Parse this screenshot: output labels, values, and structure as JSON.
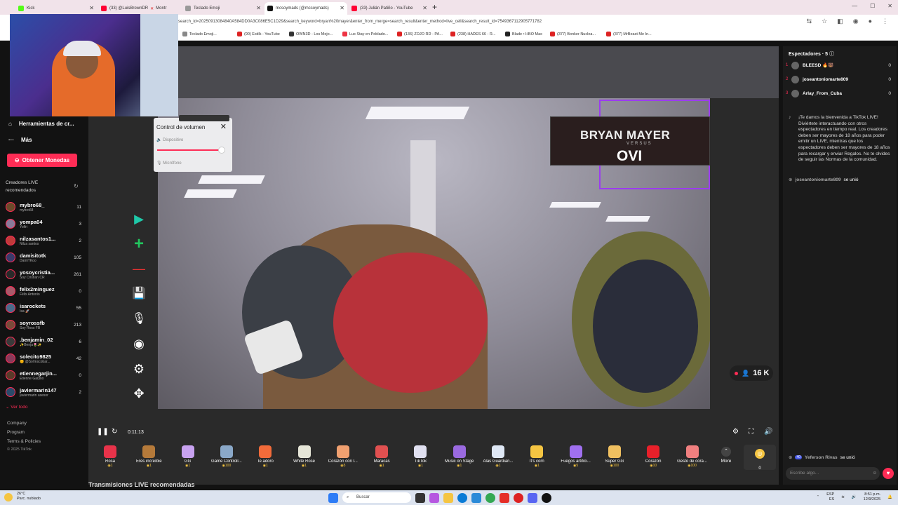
{
  "browser": {
    "tabs": [
      {
        "label": "Kick",
        "color": "#53fc18"
      },
      {
        "label": "(33) @LuisBrownDR",
        "color": "#ff0033"
      },
      {
        "label": "Montr",
        "color": "#888888"
      },
      {
        "label": "Teclado Emoji",
        "color": "#999999"
      },
      {
        "label": "mcsoymads (@mcsoymads)",
        "color": "#111111"
      },
      {
        "label": "(33) Julián Patiño - YouTube",
        "color": "#ff0033"
      }
    ],
    "new_tab": "+",
    "url": "search_id=20250913084840A584DD0A3C086E5C1D29&search_keyword=bryan%20mayer&enter_from_merge=search_result&enter_method=live_cell&search_result_id=7549367112905771782",
    "bookmarks": [
      "Teclado Emoji...",
      "(90) Estilk - YouTube",
      "OWN3D - Los Mejo...",
      "Lux Stay en Poblado...",
      "(136) ZOJO RD - PA...",
      "(238) HADES 66 - R...",
      "Blade • HBO Max",
      "(377) Bonker Nuclea...",
      "(377) MrBeast Me In..."
    ]
  },
  "sidebar": {
    "tools_label": "Herramientas de cr...",
    "more_label": "Más",
    "coins_button": "Obtener Monedas",
    "recommended_title": "Creadores LIVE recomendados",
    "creators": [
      {
        "name": "mybro68_",
        "sub": "mybro68",
        "count": "11"
      },
      {
        "name": "yompa04",
        "sub": "Yolfri",
        "count": "3"
      },
      {
        "name": "nilzasantos1...",
        "sub": "Nilza santos",
        "count": "2"
      },
      {
        "name": "damisitotk",
        "sub": "DamiTKoo",
        "count": "105"
      },
      {
        "name": "yosoycristia...",
        "sub": "Soy Cristian CR",
        "count": "261"
      },
      {
        "name": "felix2minguez",
        "sub": "Félix Antonio",
        "count": "0"
      },
      {
        "name": "isarockets",
        "sub": "Isa 🚀",
        "count": "55"
      },
      {
        "name": "soyrossfb",
        "sub": "Soy Ross FB",
        "count": "213"
      },
      {
        "name": ".benjamin_02",
        "sub": "✨Benja🌷✨",
        "count": "6"
      },
      {
        "name": "solecito9825",
        "sub": "🌞 @Sol Escobar...",
        "count": "42"
      },
      {
        "name": "etiennegarjin...",
        "sub": "Etienne Garjino",
        "count": "0"
      },
      {
        "name": "javiermarin147",
        "sub": "javiermarin asesor",
        "count": "2"
      }
    ],
    "see_all": "Ver todo",
    "footer_links": [
      "Company",
      "Program",
      "Terms & Policies"
    ],
    "copyright": "© 2025 TikTok"
  },
  "volume_popup": {
    "title": "Control de volumen",
    "device_label": "Dispositivo",
    "mic_label": "Micrófono",
    "level": 0.9
  },
  "video": {
    "overlay_title": "BRYAN MAYER",
    "overlay_versus": "VERSUS",
    "overlay_name": "OVI",
    "viewers": "16 K"
  },
  "controls": {
    "time": "0:11:13"
  },
  "gifts": [
    {
      "name": "Rosa",
      "cost": "1",
      "color": "#e8334a"
    },
    {
      "name": "Eres increíble",
      "cost": "1",
      "color": "#b57a3a"
    },
    {
      "name": "GG",
      "cost": "1",
      "color": "#c8a2f0"
    },
    {
      "name": "Game Controll...",
      "cost": "100",
      "color": "#8aa8c8"
    },
    {
      "name": "Te adoro",
      "cost": "1",
      "color": "#f26b3a"
    },
    {
      "name": "White Rose",
      "cost": "1",
      "color": "#e6e6d8"
    },
    {
      "name": "Corazón con l...",
      "cost": "5",
      "color": "#f0a070"
    },
    {
      "name": "Maracas",
      "cost": "1",
      "color": "#e05050"
    },
    {
      "name": "TikTok",
      "cost": "1",
      "color": "#e0e0f0"
    },
    {
      "name": "Music on Stage",
      "cost": "1",
      "color": "#9a6ae0"
    },
    {
      "name": "Alas Guardian...",
      "cost": "1",
      "color": "#dfe8f5"
    },
    {
      "name": "It's corn",
      "cost": "1",
      "color": "#f5c542"
    },
    {
      "name": "Fuegos artifici...",
      "cost": "5",
      "color": "#a070f0"
    },
    {
      "name": "Súper GG",
      "cost": "100",
      "color": "#f0c060"
    },
    {
      "name": "Corazón",
      "cost": "10",
      "color": "#e8202a"
    },
    {
      "name": "Gesto de cora...",
      "cost": "100",
      "color": "#f08080"
    }
  ],
  "more_gifts": "More",
  "coin_balance": "0",
  "recommended_live_title": "Transmisiones LIVE recomendadas",
  "chat": {
    "spectators_title": "Espectadores · 5",
    "spectators": [
      {
        "rank": "1",
        "name": "BLEESD 🔥🐻",
        "value": "0"
      },
      {
        "rank": "2",
        "name": "joseantoniomarte809",
        "value": "0"
      },
      {
        "rank": "3",
        "name": "Arlay_From_Cuba",
        "value": "0"
      }
    ],
    "welcome": "¡Te damos la bienvenida a TikTok LIVE! Diviértete interactuando con otros espectadores en tiempo real. Los creadores deben ser mayores de 18 años para poder emitir un LIVE, mientras que los espectadores deben ser mayores de 18 años para recargar y enviar Regalos. No te olvides de seguir las Normas de la comunidad.",
    "join1_user": "joseantoniomarte809",
    "join1_text": "se unió",
    "join2_badge": "40",
    "join2_user": "Yeferson Rivas",
    "join2_text": "se unió",
    "input_placeholder": "Escribe algo..."
  },
  "taskbar": {
    "temp": "26°C",
    "weather": "Parc. nublado",
    "search": "Buscar",
    "lang1": "ESP",
    "lang2": "ES",
    "time": "8:51 p.m.",
    "date": "12/9/2025"
  }
}
